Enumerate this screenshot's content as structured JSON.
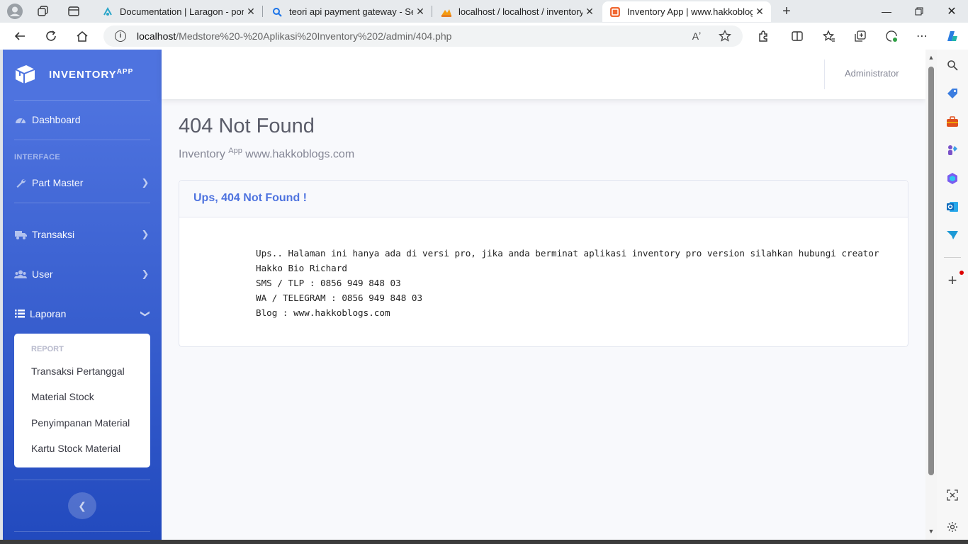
{
  "browser": {
    "tabs": [
      {
        "title": "Documentation | Laragon - porta",
        "icon": "laragon-icon"
      },
      {
        "title": "teori api payment gateway - Sear",
        "icon": "search-icon"
      },
      {
        "title": "localhost / localhost / inventory_",
        "icon": "phpmyadmin-icon"
      },
      {
        "title": "Inventory App | www.hakkoblogs",
        "icon": "app-icon",
        "active": true
      }
    ],
    "address": {
      "host": "localhost",
      "path": "/Medstore%20-%20Aplikasi%20Inventory%202/admin/404.php"
    },
    "read_aloud_glyph": "Aʼ"
  },
  "sidebar": {
    "brand": {
      "name": "INVENTORY",
      "sup": "APP"
    },
    "dashboard": "Dashboard",
    "heading_interface": "INTERFACE",
    "items": [
      {
        "label": "Part Master",
        "icon": "wrench-icon"
      },
      {
        "label": "Transaksi",
        "icon": "truck-icon"
      },
      {
        "label": "User",
        "icon": "users-icon"
      },
      {
        "label": "Laporan",
        "icon": "list-icon",
        "expanded": true
      }
    ],
    "report": {
      "heading": "REPORT",
      "links": [
        "Transaksi Pertanggal",
        "Material Stock",
        "Penyimpanan Material",
        "Kartu Stock Material"
      ]
    }
  },
  "topbar": {
    "user": "Administrator"
  },
  "page": {
    "title": "404 Not Found",
    "subtitle_prefix": "Inventory",
    "subtitle_sup": "App",
    "subtitle_suffix": "www.hakkoblogs.com"
  },
  "card": {
    "title": "Ups, 404 Not Found !",
    "lines": [
      "Ups.. Halaman ini hanya ada di versi pro, jika anda berminat aplikasi inventory pro version silahkan hubungi creator",
      "Hakko Bio Richard",
      "SMS / TLP : 0856 949 848 03",
      "WA / TELEGRAM : 0856 949 848 03",
      "Blog : www.hakkoblogs.com"
    ]
  },
  "colors": {
    "primary": "#4e73df",
    "sidebar_gradient_end": "#224abe",
    "text_gray": "#858796",
    "title_gray": "#5a5c69"
  }
}
